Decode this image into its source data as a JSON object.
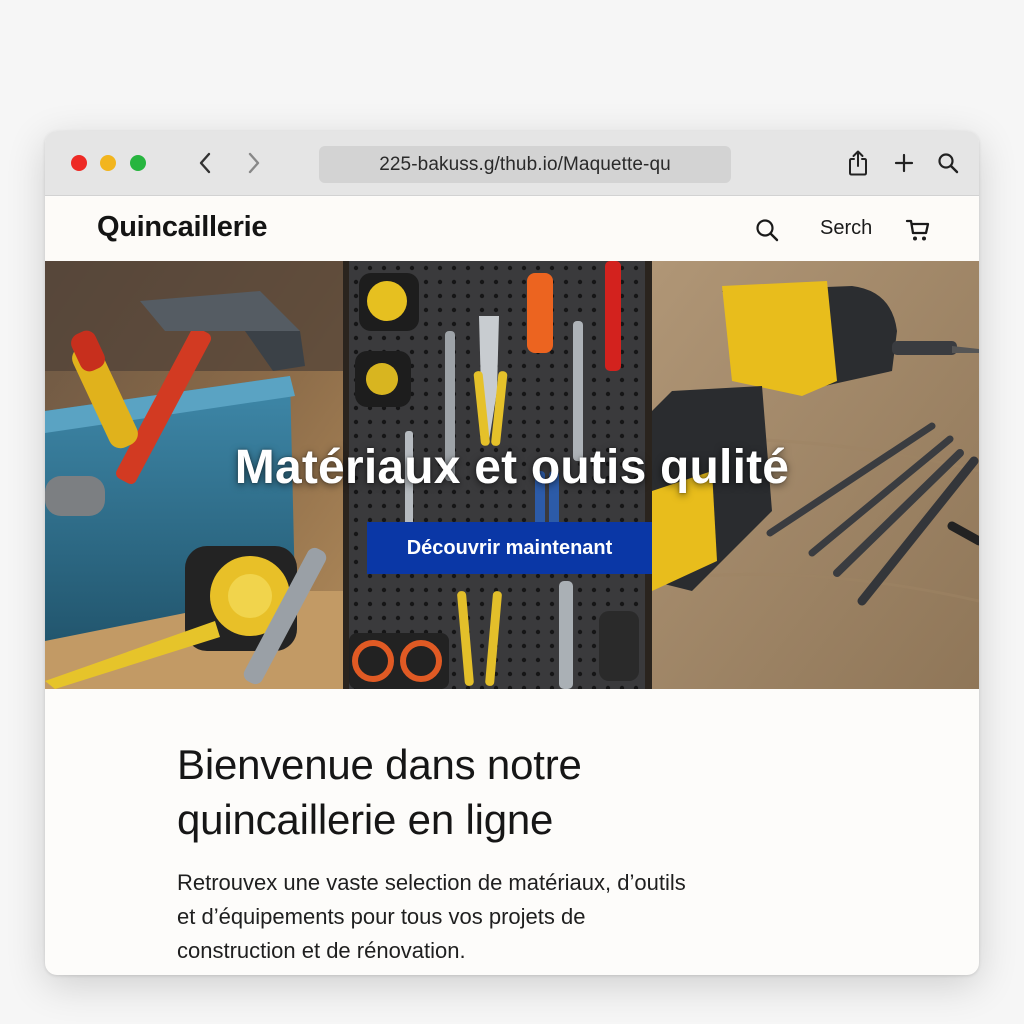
{
  "browser": {
    "url": "225-bakuss.g/thub.io/Maquette-qu",
    "controls": [
      "close",
      "minimize",
      "maximize"
    ],
    "icons": [
      "chevron-left-icon",
      "chevron-right-icon",
      "share-icon",
      "plus-icon",
      "search-icon"
    ]
  },
  "header": {
    "brand": "Quincaillerie",
    "search_label": "Serch",
    "icons": [
      "search-icon",
      "cart-icon"
    ]
  },
  "hero": {
    "title": "Matériaux et outis qulité",
    "cta_label": "Découvrir maintenant",
    "cta_color": "#0a37a6",
    "images": [
      "toolbox with hammer, screwdriver and tape measure",
      "pegboard with hanging tools",
      "yellow cordless drill with drill bits"
    ]
  },
  "welcome": {
    "title_line1": "Bienvenue dans notre",
    "title_line2": "quincaillerie en ligne",
    "text_line1": "Retrouvex une vaste selection de matériaux, d’outils",
    "text_line2": "et d’équipements pour tous vos projets de",
    "text_line3": "construction et de rénovation."
  }
}
